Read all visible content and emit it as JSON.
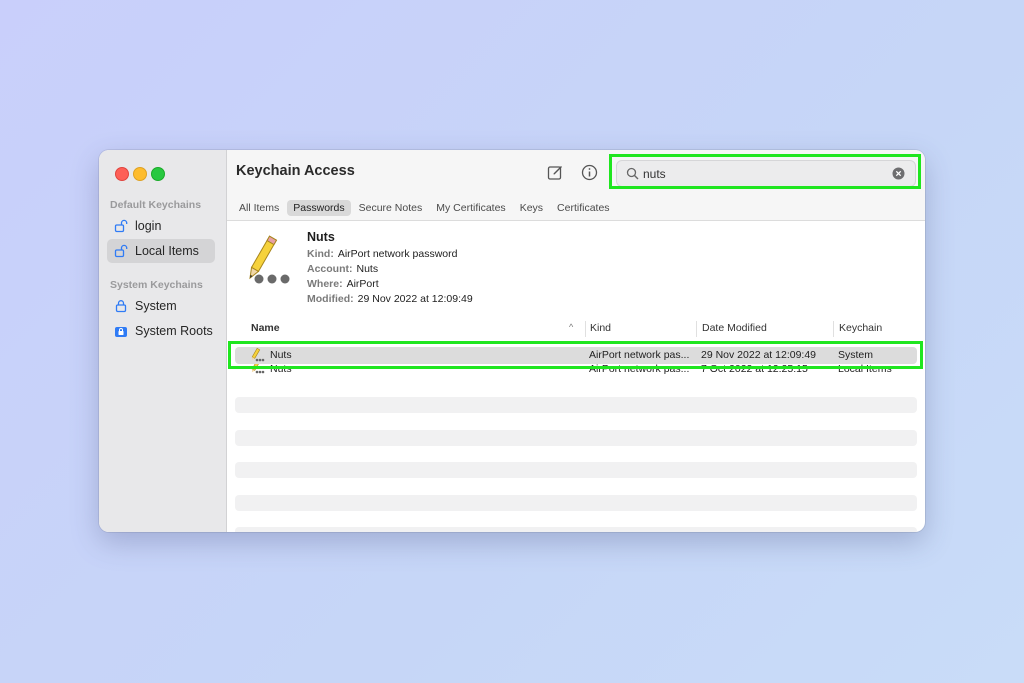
{
  "app": {
    "title": "Keychain Access"
  },
  "sidebar": {
    "default_section": "Default Keychains",
    "system_section": "System Keychains",
    "items": [
      {
        "label": "login",
        "icon": "unlock-icon"
      },
      {
        "label": "Local Items",
        "icon": "unlock-icon"
      },
      {
        "label": "System",
        "icon": "lock-icon"
      },
      {
        "label": "System Roots",
        "icon": "lock-icon"
      }
    ]
  },
  "toolbar": {
    "compose_icon": "compose-icon",
    "info_icon": "info-icon"
  },
  "search": {
    "value": "nuts"
  },
  "tabs": [
    "All Items",
    "Passwords",
    "Secure Notes",
    "My Certificates",
    "Keys",
    "Certificates"
  ],
  "active_tab": "Passwords",
  "detail": {
    "name": "Nuts",
    "kind_label": "Kind:",
    "kind": "AirPort network password",
    "account_label": "Account:",
    "account": "Nuts",
    "where_label": "Where:",
    "where": "AirPort",
    "modified_label": "Modified:",
    "modified": "29 Nov 2022 at 12:09:49"
  },
  "table": {
    "columns": [
      "Name",
      "Kind",
      "Date Modified",
      "Keychain"
    ],
    "rows": [
      {
        "name": "Nuts",
        "kind": "AirPort network pas...",
        "date": "29 Nov 2022 at 12:09:49",
        "keychain": "System"
      },
      {
        "name": "Nuts",
        "kind": "AirPort network pas...",
        "date": "7 Oct 2022 at 12:25:15",
        "keychain": "Local Items"
      }
    ]
  },
  "colors": {
    "highlight": "#1fe61f",
    "close": "#fe5f57",
    "minimize": "#febc2e",
    "maximize": "#28c840"
  }
}
